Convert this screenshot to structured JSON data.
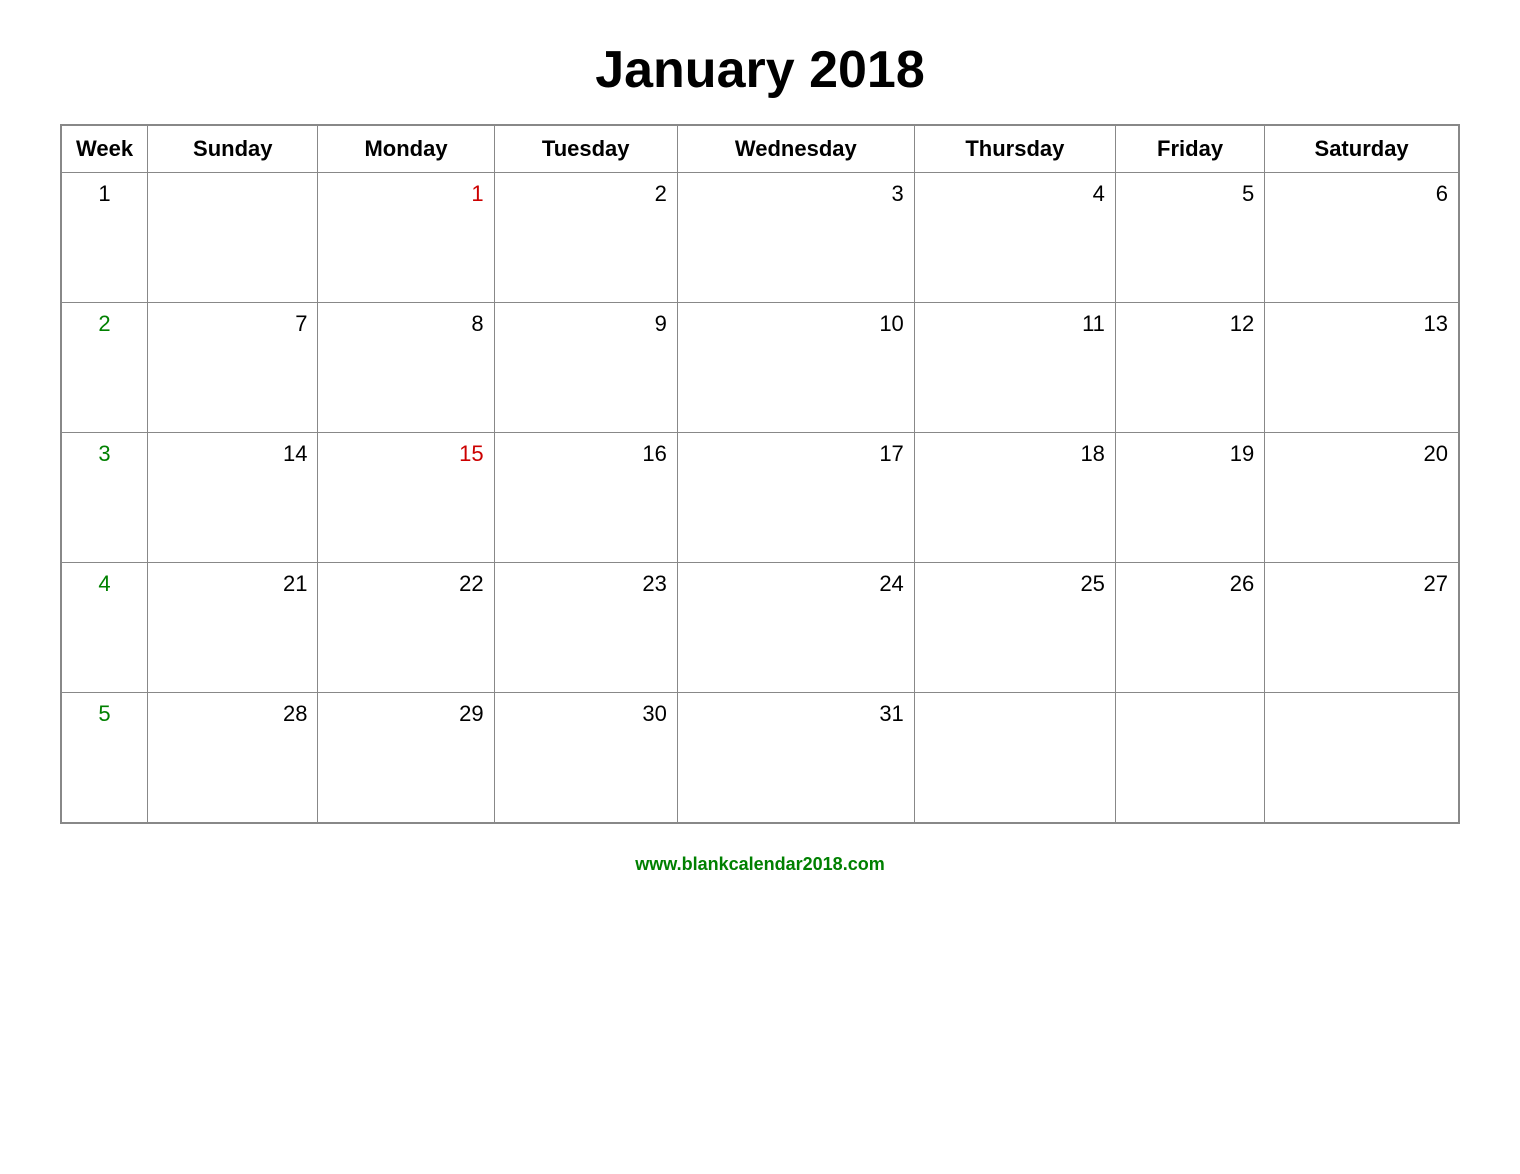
{
  "header": {
    "title": "January 2018"
  },
  "columns": [
    "Week",
    "Sunday",
    "Monday",
    "Tuesday",
    "Wednesday",
    "Thursday",
    "Friday",
    "Saturday"
  ],
  "weeks": [
    {
      "week_num": "1",
      "week_color": "black",
      "days": [
        {
          "day": "",
          "color": "normal"
        },
        {
          "day": "1",
          "color": "red"
        },
        {
          "day": "2",
          "color": "normal"
        },
        {
          "day": "3",
          "color": "normal"
        },
        {
          "day": "4",
          "color": "normal"
        },
        {
          "day": "5",
          "color": "normal"
        },
        {
          "day": "6",
          "color": "normal"
        }
      ]
    },
    {
      "week_num": "2",
      "week_color": "green",
      "days": [
        {
          "day": "7",
          "color": "normal"
        },
        {
          "day": "8",
          "color": "normal"
        },
        {
          "day": "9",
          "color": "normal"
        },
        {
          "day": "10",
          "color": "normal"
        },
        {
          "day": "11",
          "color": "normal"
        },
        {
          "day": "12",
          "color": "normal"
        },
        {
          "day": "13",
          "color": "normal"
        }
      ]
    },
    {
      "week_num": "3",
      "week_color": "green",
      "days": [
        {
          "day": "14",
          "color": "normal"
        },
        {
          "day": "15",
          "color": "red"
        },
        {
          "day": "16",
          "color": "normal"
        },
        {
          "day": "17",
          "color": "normal"
        },
        {
          "day": "18",
          "color": "normal"
        },
        {
          "day": "19",
          "color": "normal"
        },
        {
          "day": "20",
          "color": "normal"
        }
      ]
    },
    {
      "week_num": "4",
      "week_color": "green",
      "days": [
        {
          "day": "21",
          "color": "normal"
        },
        {
          "day": "22",
          "color": "normal"
        },
        {
          "day": "23",
          "color": "normal"
        },
        {
          "day": "24",
          "color": "normal"
        },
        {
          "day": "25",
          "color": "normal"
        },
        {
          "day": "26",
          "color": "normal"
        },
        {
          "day": "27",
          "color": "normal"
        }
      ]
    },
    {
      "week_num": "5",
      "week_color": "green",
      "days": [
        {
          "day": "28",
          "color": "normal"
        },
        {
          "day": "29",
          "color": "normal"
        },
        {
          "day": "30",
          "color": "normal"
        },
        {
          "day": "31",
          "color": "normal"
        },
        {
          "day": "",
          "color": "normal"
        },
        {
          "day": "",
          "color": "normal"
        },
        {
          "day": "",
          "color": "normal"
        }
      ]
    }
  ],
  "footer": {
    "url": "www.blankcalendar2018.com"
  }
}
